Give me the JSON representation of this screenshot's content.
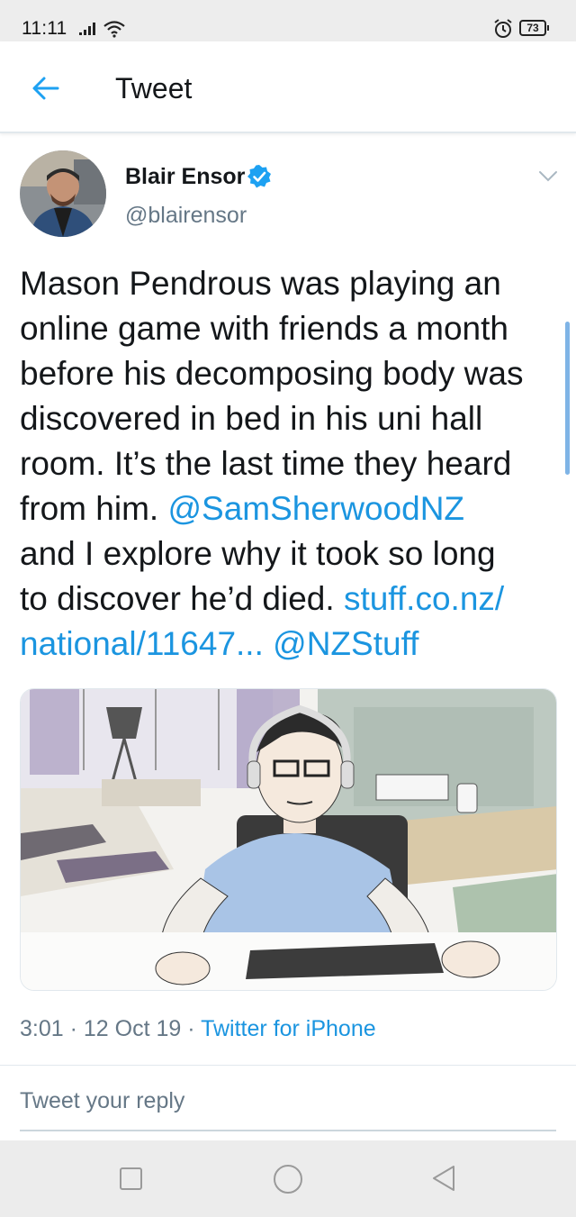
{
  "status_bar": {
    "time": "11:11",
    "battery": "73",
    "icons": [
      "signal-icon",
      "wifi-icon",
      "alarm-icon",
      "battery-icon"
    ]
  },
  "header": {
    "title": "Tweet",
    "back_icon": "arrow-left-icon"
  },
  "tweet": {
    "author_name": "Blair Ensor",
    "author_handle": "@blairensor",
    "verified": true,
    "text_lines": [
      [
        {
          "t": "Mason Pendrous was playing an",
          "link": false
        }
      ],
      [
        {
          "t": "online game with friends a month",
          "link": false
        }
      ],
      [
        {
          "t": "before his decomposing body was",
          "link": false
        }
      ],
      [
        {
          "t": "discovered in bed in his uni hall",
          "link": false
        }
      ],
      [
        {
          "t": "room. It’s the last time they heard",
          "link": false
        }
      ],
      [
        {
          "t": "from him. ",
          "link": false
        },
        {
          "t": "@SamSherwoodNZ",
          "link": true
        }
      ],
      [
        {
          "t": "and I explore why it took so long",
          "link": false
        }
      ],
      [
        {
          "t": "to discover he’d died. ",
          "link": false
        },
        {
          "t": "stuff.co.nz/",
          "link": true
        }
      ],
      [
        {
          "t": "national/11647...",
          "link": true
        },
        {
          "t": " ",
          "link": false
        },
        {
          "t": "@NZStuff",
          "link": true
        }
      ]
    ],
    "time": "3:01",
    "date": "12 Oct 19",
    "separator": "·",
    "source": "Twitter for iPhone"
  },
  "reply": {
    "placeholder": "Tweet your reply"
  },
  "colors": {
    "link": "#1b95e0",
    "verified": "#1da1f2",
    "secondary_text": "#657786"
  }
}
